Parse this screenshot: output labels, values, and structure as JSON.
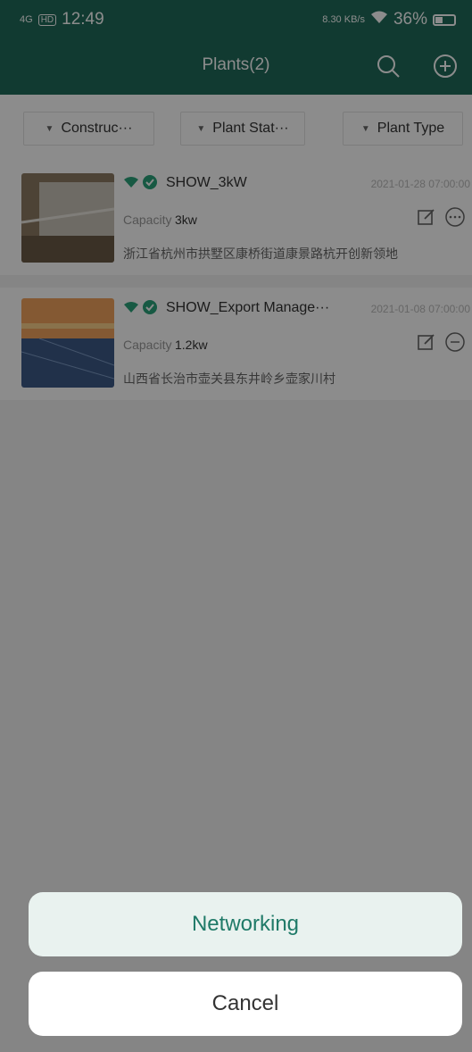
{
  "status_bar": {
    "network": "4G",
    "hd": "HD",
    "time": "12:49",
    "speed": "8.30 KB/s",
    "battery": "36%",
    "battery_level": 0.36
  },
  "appbar": {
    "title": "Plants(2)",
    "search_icon": "search-icon",
    "add_icon": "add-circle-icon"
  },
  "filters": [
    {
      "label": "Construc···"
    },
    {
      "label": "Plant Stat···"
    },
    {
      "label": "Plant Type"
    }
  ],
  "plants": [
    {
      "name": "SHOW_3kW",
      "timestamp": "2021-01-28 07:00:00",
      "capacity_label": "Capacity",
      "capacity": "3kw",
      "address": "浙江省杭州市拱墅区康桥街道康景路杭开创新领地"
    },
    {
      "name": "SHOW_Export Manage···",
      "timestamp": "2021-01-08 07:00:00",
      "capacity_label": "Capacity",
      "capacity": "1.2kw",
      "address": "山西省长治市壶关县东井岭乡壶家川村"
    }
  ],
  "sheet": {
    "networking": "Networking",
    "cancel": "Cancel"
  },
  "colors": {
    "brand": "#1f6b5a",
    "accent_text": "#1f7a68",
    "online": "#2aa37a"
  }
}
